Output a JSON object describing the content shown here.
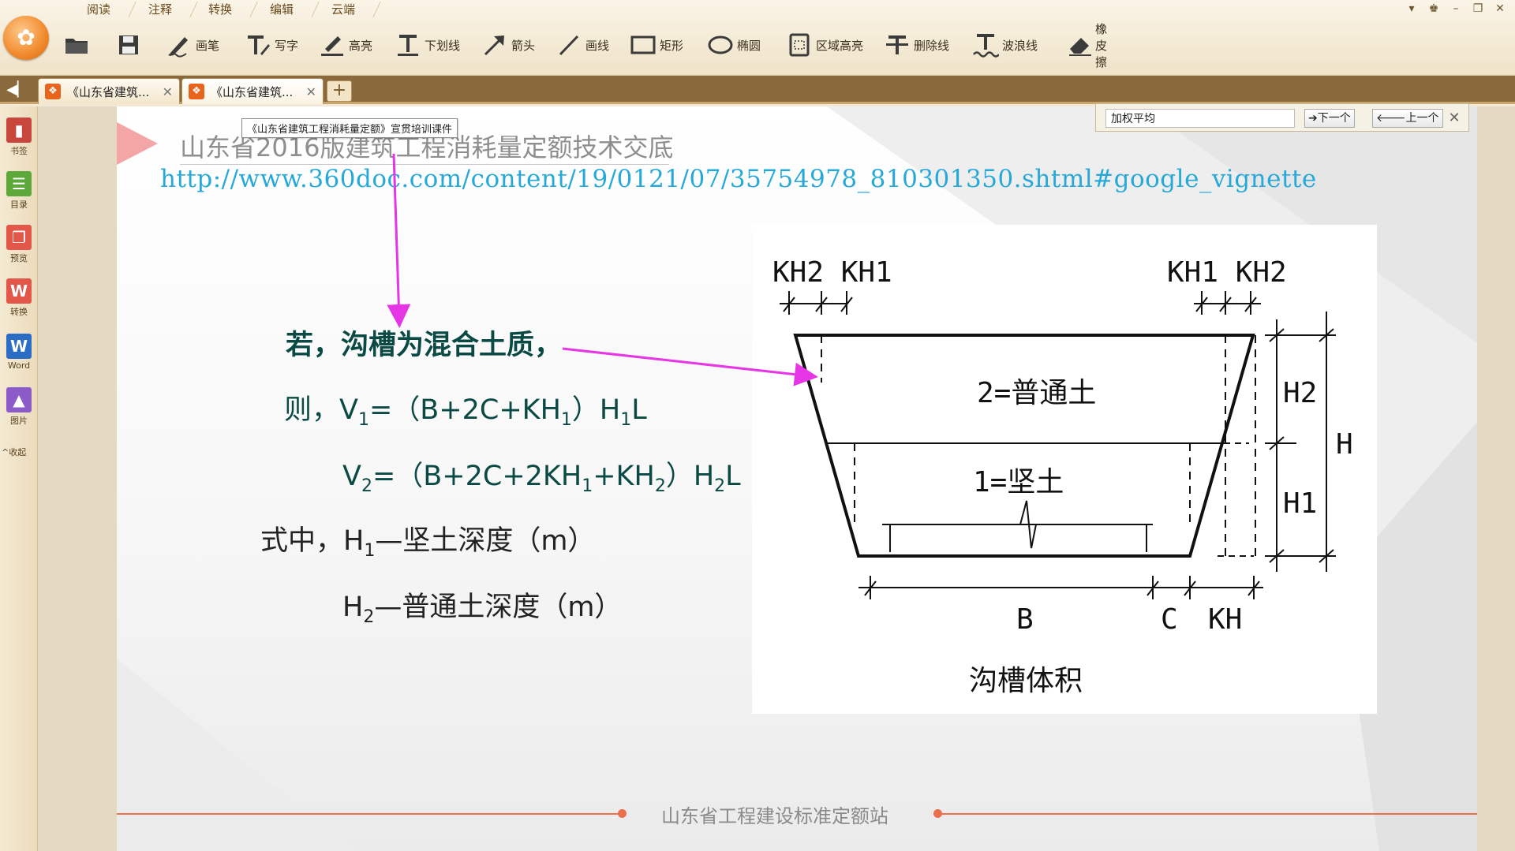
{
  "menu_tabs": [
    "阅读",
    "注释",
    "转换",
    "编辑",
    "云端"
  ],
  "tools": [
    {
      "label": "",
      "icon": "folder-open-icon"
    },
    {
      "label": "",
      "icon": "save-icon"
    },
    {
      "label": "画笔",
      "icon": "pen-icon"
    },
    {
      "label": "写字",
      "icon": "text-tool-icon"
    },
    {
      "label": "高亮",
      "icon": "highlight-icon"
    },
    {
      "label": "下划线",
      "icon": "underline-icon"
    },
    {
      "label": "箭头",
      "icon": "arrow-tool-icon"
    },
    {
      "label": "画线",
      "icon": "line-tool-icon"
    },
    {
      "label": "矩形",
      "icon": "rectangle-icon"
    },
    {
      "label": "椭圆",
      "icon": "ellipse-icon"
    },
    {
      "label": "区域高亮",
      "icon": "area-highlight-icon"
    },
    {
      "label": "删除线",
      "icon": "strikethrough-icon"
    },
    {
      "label": "波浪线",
      "icon": "wavy-line-icon"
    },
    {
      "label": "橡皮擦",
      "icon": "eraser-icon"
    }
  ],
  "tabs": [
    {
      "label": "《山东省建筑...",
      "active": false
    },
    {
      "label": "《山东省建筑...",
      "active": true
    }
  ],
  "tab_add": "+",
  "sidebar": [
    {
      "label": "书签",
      "icon": "bookmark-icon",
      "color": "#c8463b"
    },
    {
      "label": "目录",
      "icon": "toc-icon",
      "color": "#5da83a"
    },
    {
      "label": "预览",
      "icon": "preview-icon",
      "color": "#e2574a"
    },
    {
      "label": "转换",
      "icon": "convert-icon",
      "color": "#e2574a"
    },
    {
      "label": "Word",
      "icon": "word-icon",
      "color": "#2b6cc4"
    },
    {
      "label": "图片",
      "icon": "image-icon",
      "color": "#8a5bc9"
    }
  ],
  "sidebar_collapse": "^收起",
  "find": {
    "value": "加权平均",
    "next_label": "➔下一个",
    "prev_label": "🡐上一个"
  },
  "slide": {
    "tooltip": "《山东省建筑工程消耗量定额》宣贯培训课件",
    "title": "山东省2016版建筑工程消耗量定额技术交底",
    "url": "http://www.360doc.com/content/19/0121/07/35754978_810301350.shtml#google_vignette",
    "line1": "若，沟槽为混合土质，",
    "line2_prefix": "则，V",
    "line4": "式中，H",
    "footer": "山东省工程建设标准定额站",
    "diagram": {
      "labels_top_left": "KH2 KH1",
      "labels_top_right": "KH1 KH2",
      "layer2": "2=普通土",
      "layer1": "1=坚土",
      "h2": "H2",
      "h1": "H1",
      "h": "H",
      "b": "B",
      "c": "C",
      "kh": "KH",
      "caption": "沟槽体积"
    }
  },
  "colors": {
    "accent_arrow": "#e535e5",
    "formula": "#0b4a44",
    "url": "#26a9d9",
    "footer_line": "#ea6f4a"
  }
}
